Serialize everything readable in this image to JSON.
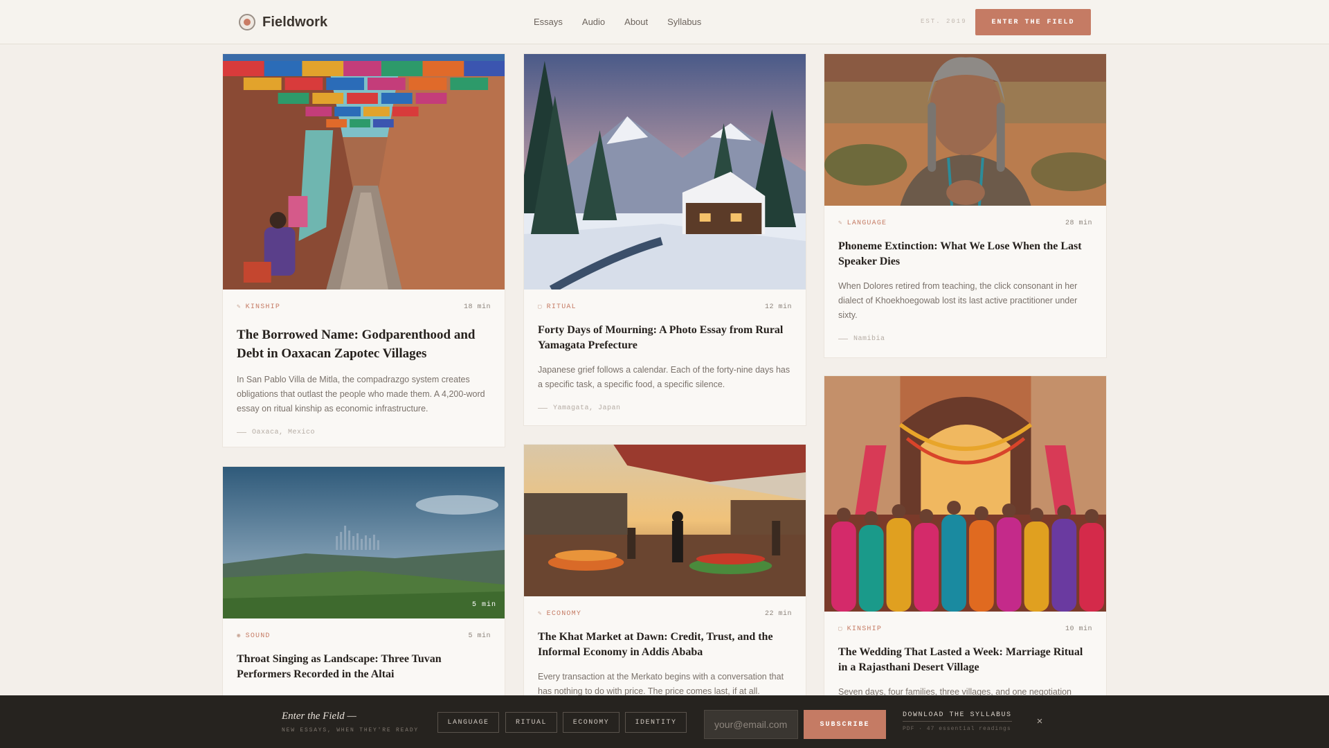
{
  "header": {
    "brand": "Fieldwork",
    "nav": [
      "Essays",
      "Audio",
      "About",
      "Syllabus"
    ],
    "est": "EST. 2019",
    "cta": "ENTER THE FIELD"
  },
  "cards": [
    {
      "tag": "KINSHIP",
      "tag_icon": "pen-icon",
      "readtime": "18 min",
      "title": "The Borrowed Name: Godparenthood and Debt in Oaxacan Zapotec Villages",
      "excerpt": "In San Pablo Villa de Mitla, the compadrazgo system creates obligations that outlast the people who made them. A 4,200-word essay on ritual kinship as economic infrastructure.",
      "place": "Oaxaca, Mexico",
      "image": "market-street-with-papel-picado-banners"
    },
    {
      "tag": "RITUAL",
      "tag_icon": "square-icon",
      "readtime": "12 min",
      "title": "Forty Days of Mourning: A Photo Essay from Rural Yamagata Prefecture",
      "excerpt": "Japanese grief follows a calendar. Each of the forty-nine days has a specific task, a specific food, a specific silence.",
      "place": "Yamagata, Japan",
      "image": "snowy-mountain-cabin-at-dusk"
    },
    {
      "tag": "LANGUAGE",
      "tag_icon": "pen-icon",
      "readtime": "28 min",
      "title": "Phoneme Extinction: What We Lose When the Last Speaker Dies",
      "excerpt": "When Dolores retired from teaching, the click consonant in her dialect of Khoekhoegowab lost its last active practitioner under sixty.",
      "place": "Namibia",
      "image": "portrait-elder-woman-in-desert"
    },
    {
      "tag": "SOUND",
      "tag_icon": "speaker-icon",
      "readtime": "5 min",
      "badge": "5 min",
      "title": "Throat Singing as Landscape: Three Tuvan Performers Recorded in the Altai",
      "excerpt": "",
      "place": "",
      "image": "steppe-landscape-with-waveform"
    },
    {
      "tag": "ECONOMY",
      "tag_icon": "pen-icon",
      "readtime": "22 min",
      "title": "The Khat Market at Dawn: Credit, Trust, and the Informal Economy in Addis Ababa",
      "excerpt": "Every transaction at the Merkato begins with a conversation that has nothing to do with price. The price comes last, if at all.",
      "place": "",
      "image": "open-air-market-at-sunrise"
    },
    {
      "tag": "KINSHIP",
      "tag_icon": "square-icon",
      "readtime": "10 min",
      "title": "The Wedding That Lasted a Week: Marriage Ritual in a Rajasthani Desert Village",
      "excerpt": "Seven days, four families, three villages, and one negotiation",
      "place": "",
      "image": "wedding-procession-women-in-saris"
    }
  ],
  "bottom_bar": {
    "title": "Enter the Field —",
    "subtitle": "NEW ESSAYS, WHEN THEY'RE READY",
    "topics": [
      "LANGUAGE",
      "RITUAL",
      "ECONOMY",
      "IDENTITY"
    ],
    "email_placeholder": "your@email.com",
    "subscribe": "SUBSCRIBE",
    "download_label": "DOWNLOAD THE SYLLABUS",
    "download_sub": "PDF · 47 essential readings",
    "close": "×"
  },
  "colors": {
    "accent": "#c57b64",
    "page_bg": "#f3efea",
    "card_bg": "#faf8f5",
    "bar_bg": "#26231f"
  }
}
